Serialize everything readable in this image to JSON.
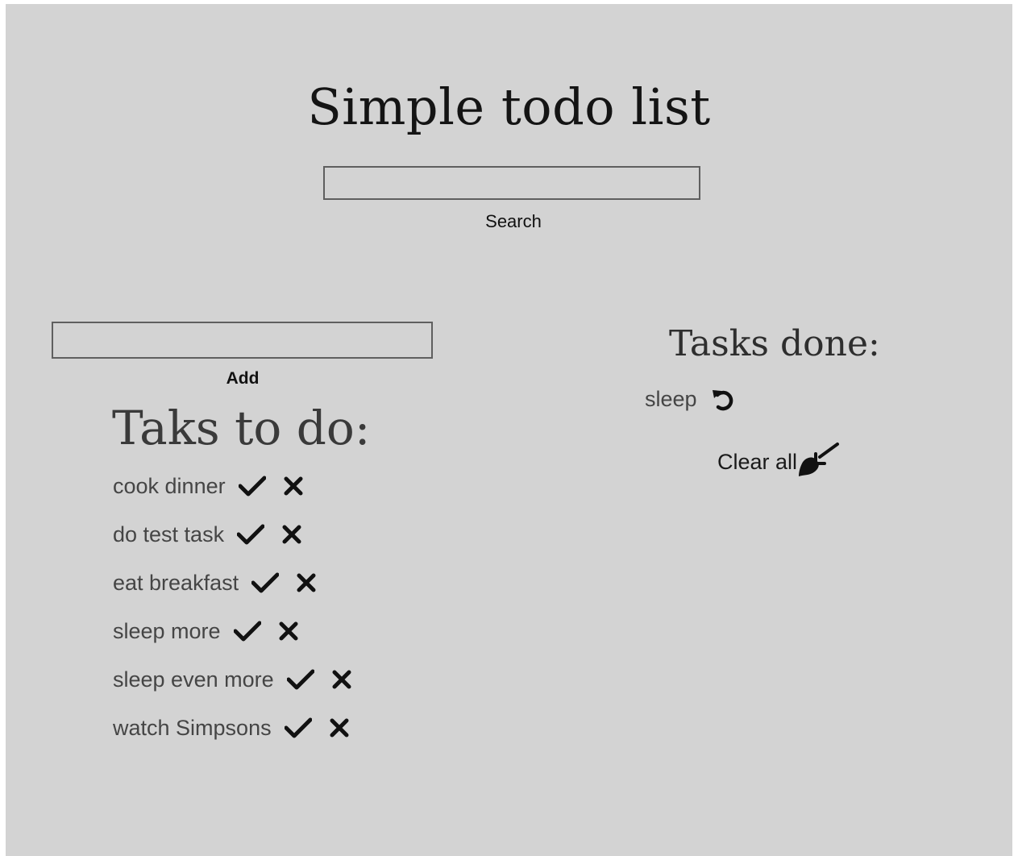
{
  "page": {
    "title": "Simple todo list"
  },
  "search": {
    "value": "",
    "placeholder": "",
    "button_label": "Search"
  },
  "add": {
    "value": "",
    "placeholder": "",
    "button_label": "Add"
  },
  "todo": {
    "heading": "Taks to do:",
    "items": [
      {
        "label": "cook dinner"
      },
      {
        "label": "do test task"
      },
      {
        "label": "eat breakfast"
      },
      {
        "label": "sleep more"
      },
      {
        "label": "sleep even more"
      },
      {
        "label": "watch Simpsons"
      }
    ]
  },
  "done": {
    "heading": "Tasks done:",
    "items": [
      {
        "label": "sleep"
      }
    ],
    "clear_all_label": "Clear all"
  },
  "icons": {
    "complete": "check-icon",
    "remove": "close-icon",
    "restore": "undo-icon",
    "clear": "broom-icon"
  },
  "colors": {
    "background": "#d3d3d3",
    "input_border": "#5f5f5f",
    "text": "#454545"
  }
}
